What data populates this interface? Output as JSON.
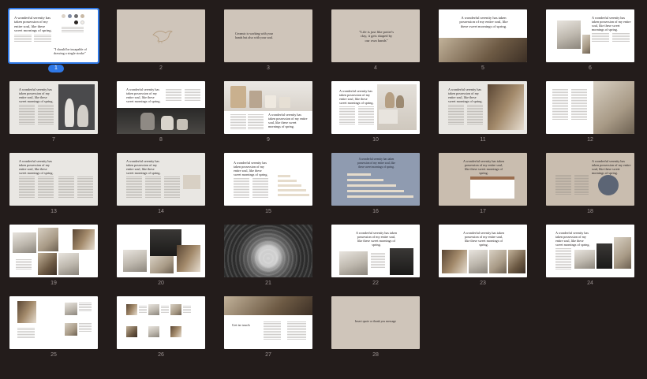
{
  "window": {
    "selected_slide": 1
  },
  "slides": [
    {
      "number": "1",
      "title": "A wonderful serenity has taken possession of my entire soul, like these sweet mornings of spring.",
      "quote": "\"I should be incapable of drawing a single stroke\""
    },
    {
      "number": "2"
    },
    {
      "number": "3",
      "text": "Ceramic is working with your hands but also with your soul."
    },
    {
      "number": "4",
      "quote": "\"Life is just like potter's clay, it gets shaped by our own hands\""
    },
    {
      "number": "5",
      "title": "A wonderful serenity has taken possession of my entire soul, like these sweet mornings of spring."
    },
    {
      "number": "6",
      "title": "A wonderful serenity has taken possession of my entire soul, like these sweet mornings of spring."
    },
    {
      "number": "7",
      "title": "A wonderful serenity has taken possession of my entire soul, like these sweet mornings of spring."
    },
    {
      "number": "8",
      "title": "A wonderful serenity has taken possession of my entire soul, like these sweet mornings of spring."
    },
    {
      "number": "9",
      "title": "A wonderful serenity has taken possession of my entire soul, like these sweet mornings of spring."
    },
    {
      "number": "10",
      "title": "A wonderful serenity has taken possession of my entire soul, like these sweet mornings of spring."
    },
    {
      "number": "11",
      "title": "A wonderful serenity has taken possession of my entire soul, like these sweet mornings of spring."
    },
    {
      "number": "12"
    },
    {
      "number": "13",
      "title": "A wonderful serenity has taken possession of my entire soul, like these sweet mornings of spring."
    },
    {
      "number": "14",
      "title": "A wonderful serenity has taken possession of my entire soul, like these sweet mornings of spring."
    },
    {
      "number": "15",
      "title": "A wonderful serenity has taken possession of my entire soul, like these sweet mornings of spring."
    },
    {
      "number": "16",
      "title": "A wonderful serenity has taken possession of my entire soul, like these sweet mornings of spring."
    },
    {
      "number": "17",
      "title": "A wonderful serenity has taken possession of my entire soul, like these sweet mornings of spring."
    },
    {
      "number": "18",
      "title": "A wonderful serenity has taken possession of my entire soul, like these sweet mornings of spring."
    },
    {
      "number": "19"
    },
    {
      "number": "20"
    },
    {
      "number": "21"
    },
    {
      "number": "22",
      "title": "A wonderful serenity has taken possession of my entire soul, like these sweet mornings of spring."
    },
    {
      "number": "23",
      "title": "A wonderful serenity has taken possession of my entire soul, like these sweet mornings of spring."
    },
    {
      "number": "24",
      "title": "A wonderful serenity has taken possession of my entire soul, like these sweet mornings of spring."
    },
    {
      "number": "25"
    },
    {
      "number": "26"
    },
    {
      "number": "27",
      "title": "Get in touch"
    },
    {
      "number": "28",
      "text": "Insert quote or thank you message"
    }
  ],
  "colors": {
    "selection": "#2f78e6",
    "background": "#231c1b",
    "swatches": [
      "#dcd3c8",
      "#7f8aa2",
      "#6e6e70",
      "#c9b9a5",
      "#2a2522",
      "#f3efe9"
    ]
  }
}
